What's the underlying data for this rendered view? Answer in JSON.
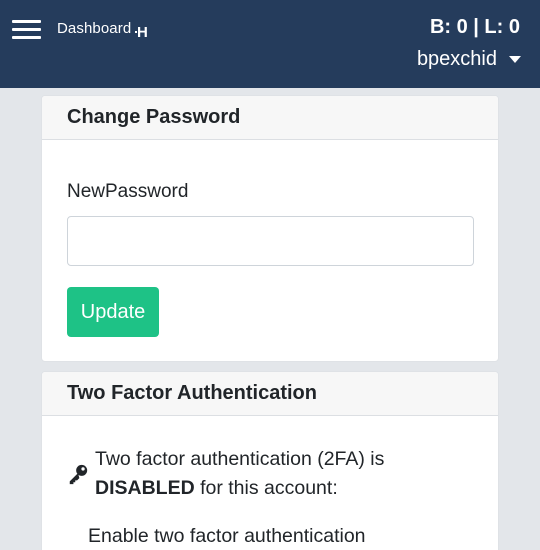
{
  "header": {
    "dashboard_label": "Dashboard",
    "logo_text": "H",
    "balance_text": "B: 0 | L: 0",
    "username": "bpexchid"
  },
  "change_password": {
    "title": "Change Password",
    "field_label": "NewPassword",
    "field_value": "",
    "update_label": "Update"
  },
  "two_factor": {
    "title": "Two Factor Authentication",
    "status_prefix": "Two factor authentication (2FA) is",
    "status_value": "DISABLED",
    "status_suffix": " for this account:",
    "enable_text": "Enable two factor authentication"
  },
  "colors": {
    "header_bg": "#253c5c",
    "update_button": "#1ec286",
    "page_bg": "#e3e6ea"
  }
}
